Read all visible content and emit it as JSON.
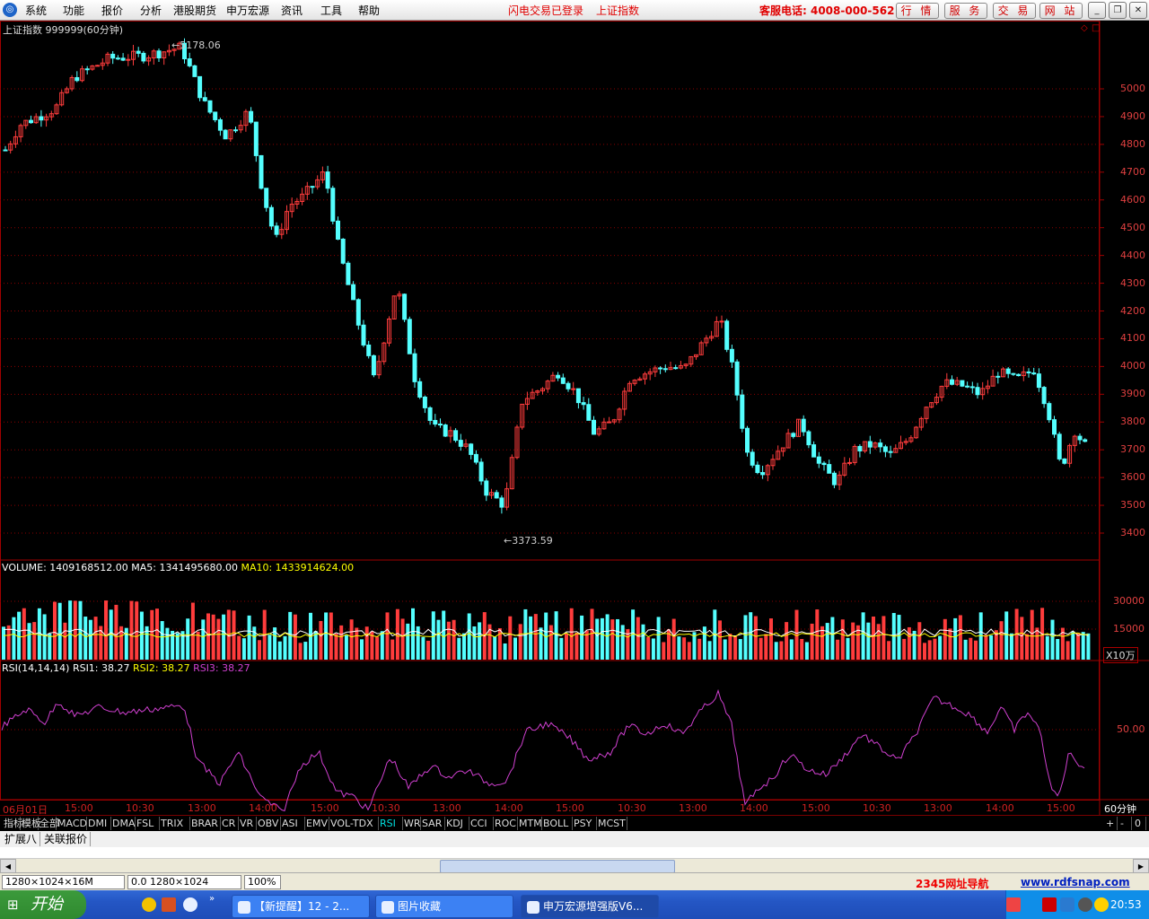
{
  "menubar": {
    "items": [
      "系统",
      "功能",
      "报价",
      "分析",
      "港股期货",
      "申万宏源",
      "资讯",
      "工具",
      "帮助"
    ],
    "login_status": "闪电交易已登录",
    "current_index": "上证指数",
    "hotline": "客服电话: 4008-000-562",
    "service_buttons": [
      "行 情",
      "服 务",
      "交 易",
      "网 站"
    ]
  },
  "price_panel": {
    "title": "上证指数 999999(60分钟)",
    "high_label": "5178.06",
    "low_label": "3373.59",
    "yaxis_ticks": [
      "5000",
      "4900",
      "4800",
      "4700",
      "4600",
      "4500",
      "4400",
      "4300",
      "4200",
      "4100",
      "4000",
      "3900",
      "3800",
      "3700",
      "3600",
      "3500",
      "3400"
    ]
  },
  "volume_panel": {
    "volume_label": "VOLUME: 1409168512.00",
    "ma5_label": "MA5: 1341495680.00",
    "ma10_label": "MA10: 1433914624.00",
    "yaxis_ticks": [
      "30000",
      "15000"
    ],
    "unit": "X10万"
  },
  "rsi_panel": {
    "rsi_name": "RSI(14,14,14)",
    "rsi1_label": "RSI1: 38.27",
    "rsi2_label": "RSI2: 38.27",
    "rsi3_label": "RSI3: 38.27",
    "yaxis_ticks": [
      "50.00"
    ]
  },
  "time_axis": {
    "labels": [
      "06月01日",
      "15:00",
      "10:30",
      "13:00",
      "14:00",
      "15:00",
      "10:30",
      "13:00",
      "14:00",
      "15:00",
      "10:30",
      "13:00",
      "14:00",
      "15:00",
      "10:30",
      "13:00",
      "14:00",
      "15:00"
    ],
    "period": "60分钟"
  },
  "indicator_tabs": [
    "指标",
    "模板",
    "全部",
    "MACD",
    "DMI",
    "DMA",
    "FSL",
    "TRIX",
    "BRAR",
    "CR",
    "VR",
    "OBV",
    "ASI",
    "EMV",
    "VOL-TDX",
    "RSI",
    "WR",
    "SAR",
    "KDJ",
    "CCI",
    "ROC",
    "MTM",
    "BOLL",
    "PSY",
    "MCST"
  ],
  "active_tab": "RSI",
  "tab_controls": [
    "+",
    "-",
    "0"
  ],
  "ext_tabs": [
    "扩展八",
    "关联报价"
  ],
  "statusbar": {
    "cells": [
      "1280×1024×16M",
      "0.0 1280×1024",
      "100%"
    ],
    "nav_link": "2345网址导航",
    "site_link": "www.rdfsnap.com"
  },
  "taskbar": {
    "start_label": "开始",
    "tasks": [
      "【新提醒】12 - 2...",
      "图片收藏",
      "申万宏源增强版V6..."
    ],
    "clock": "20:53"
  },
  "colors": {
    "up_candle": "#ff3c3c",
    "down_candle": "#54ffff",
    "panel_border": "#a00000",
    "grid": "#8a0000",
    "rsi_line": "#d040d0",
    "ma5": "#ffffff",
    "ma10": "#ffff00"
  }
}
